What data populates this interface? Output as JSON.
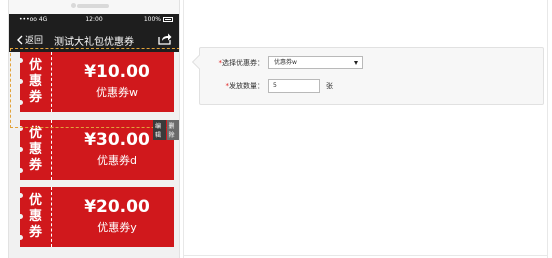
{
  "statusbar": {
    "carrier": "•••oo 4G",
    "time": "12:00",
    "battery": "100%"
  },
  "navbar": {
    "back_label": "返回",
    "title": "测试大礼包优惠券",
    "back_icon": "chevron-left-icon",
    "share_icon": "share-icon"
  },
  "coupons": [
    {
      "tag_line1": "优",
      "tag_line2": "惠",
      "tag_line3": "券",
      "amount": "¥10.00",
      "name": "优惠券w"
    },
    {
      "tag_line1": "优",
      "tag_line2": "惠",
      "tag_line3": "券",
      "amount": "¥30.00",
      "name": "优惠券d"
    },
    {
      "tag_line1": "优",
      "tag_line2": "惠",
      "tag_line3": "券",
      "amount": "¥20.00",
      "name": "优惠券y"
    }
  ],
  "coupon_actions": {
    "edit": "编辑",
    "delete": "删除"
  },
  "form": {
    "coupon_select": {
      "required_mark": "*",
      "label": "选择优惠券：",
      "value": "优惠券w"
    },
    "quantity": {
      "required_mark": "*",
      "label": "发放数量：",
      "value": "5",
      "unit": "张"
    }
  },
  "colors": {
    "coupon_red": "#d0181c",
    "navbar": "#1e1e1e",
    "selection_outline": "#e2a33a"
  }
}
